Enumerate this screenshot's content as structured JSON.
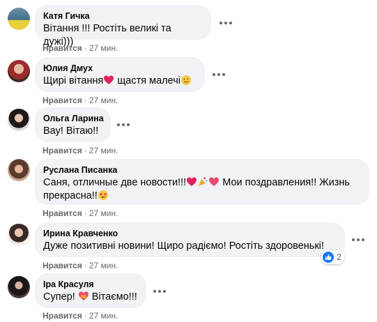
{
  "comments": [
    {
      "author": "Катя Гичка",
      "text": "Вітання !!! Ростіть великі та дужі)))",
      "like": "Нравится",
      "time": "27 мин."
    },
    {
      "author": "Юлия Дмух",
      "text_a": "Щирі вітання",
      "text_b": " щастя малечі",
      "like": "Нравится",
      "time": "27 мин."
    },
    {
      "author": "Ольга Ларина",
      "text": "Вау! Вітаю!!",
      "like": "Нравится",
      "time": "27 мин."
    },
    {
      "author": "Руслана Писанка",
      "text_a": "Саня, отличные две новости!!!",
      "text_b": " Мои поздравления!! Жизнь",
      "text_c": "прекрасна!!",
      "like": "Нравится",
      "time": "27 мин."
    },
    {
      "author": "Ирина Кравченко",
      "text": "Дуже позитивні новини! Щиро радіємо! Ростіть здоровенькі!",
      "like": "Нравится",
      "time": "27 мин.",
      "reaction_count": "2"
    },
    {
      "author": "Іра Красуля",
      "text_a": "Супер! ",
      "text_b": " Вітаємо!!!",
      "like": "Нравится",
      "time": "27 мин."
    }
  ],
  "colors": {
    "bubble": "#f0f2f5",
    "meta": "#65676b",
    "like_blue": "#1877f2"
  },
  "icons": [
    "more-options-icon",
    "heart-emoji",
    "smile-emoji",
    "party-emoji",
    "star-struck-emoji",
    "like-reaction-icon"
  ]
}
